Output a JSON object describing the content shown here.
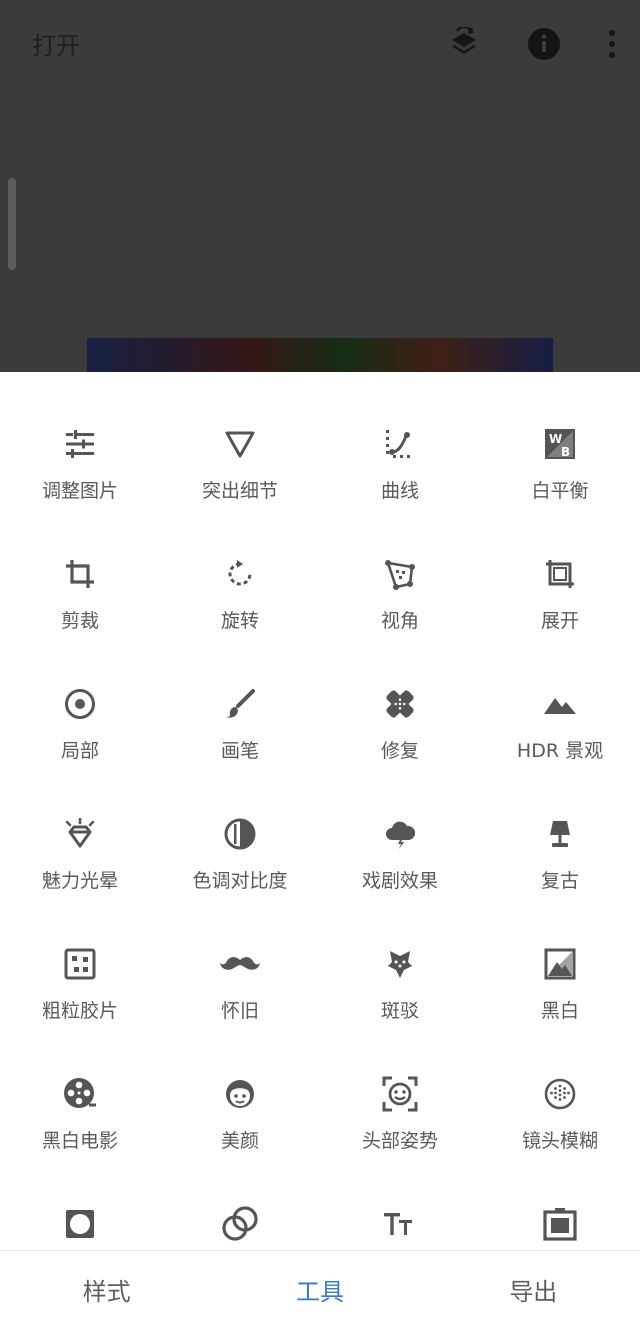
{
  "header": {
    "open_label": "打开"
  },
  "tools": [
    {
      "label": "调整图片",
      "icon": "tune-sliders-icon"
    },
    {
      "label": "突出细节",
      "icon": "details-triangle-icon"
    },
    {
      "label": "曲线",
      "icon": "curves-icon"
    },
    {
      "label": "白平衡",
      "icon": "white-balance-icon"
    },
    {
      "label": "剪裁",
      "icon": "crop-icon"
    },
    {
      "label": "旋转",
      "icon": "rotate-icon"
    },
    {
      "label": "视角",
      "icon": "perspective-icon"
    },
    {
      "label": "展开",
      "icon": "expand-icon"
    },
    {
      "label": "局部",
      "icon": "selective-icon"
    },
    {
      "label": "画笔",
      "icon": "brush-icon"
    },
    {
      "label": "修复",
      "icon": "healing-icon"
    },
    {
      "label": "HDR 景观",
      "icon": "hdr-mountain-icon"
    },
    {
      "label": "魅力光晕",
      "icon": "glamour-glow-icon"
    },
    {
      "label": "色调对比度",
      "icon": "tonal-contrast-icon"
    },
    {
      "label": "戏剧效果",
      "icon": "drama-cloud-icon"
    },
    {
      "label": "复古",
      "icon": "vintage-lamp-icon"
    },
    {
      "label": "粗粒胶片",
      "icon": "grainy-film-icon"
    },
    {
      "label": "怀旧",
      "icon": "retrolux-mustache-icon"
    },
    {
      "label": "斑驳",
      "icon": "grunge-icon"
    },
    {
      "label": "黑白",
      "icon": "black-white-icon"
    },
    {
      "label": "黑白电影",
      "icon": "noir-film-reel-icon"
    },
    {
      "label": "美颜",
      "icon": "face-smile-icon"
    },
    {
      "label": "头部姿势",
      "icon": "head-pose-icon"
    },
    {
      "label": "镜头模糊",
      "icon": "lens-blur-icon"
    },
    {
      "label": "",
      "icon": "vignette-icon"
    },
    {
      "label": "",
      "icon": "double-exposure-icon"
    },
    {
      "label": "",
      "icon": "text-icon"
    },
    {
      "label": "",
      "icon": "frames-icon"
    }
  ],
  "bottom_nav": [
    {
      "label": "样式",
      "active": false
    },
    {
      "label": "工具",
      "active": true
    },
    {
      "label": "导出",
      "active": false
    }
  ],
  "colors": {
    "accent": "#3a78c3",
    "icon": "#555555",
    "label": "#5a5a5a",
    "overlay": "#3b3b3b"
  }
}
